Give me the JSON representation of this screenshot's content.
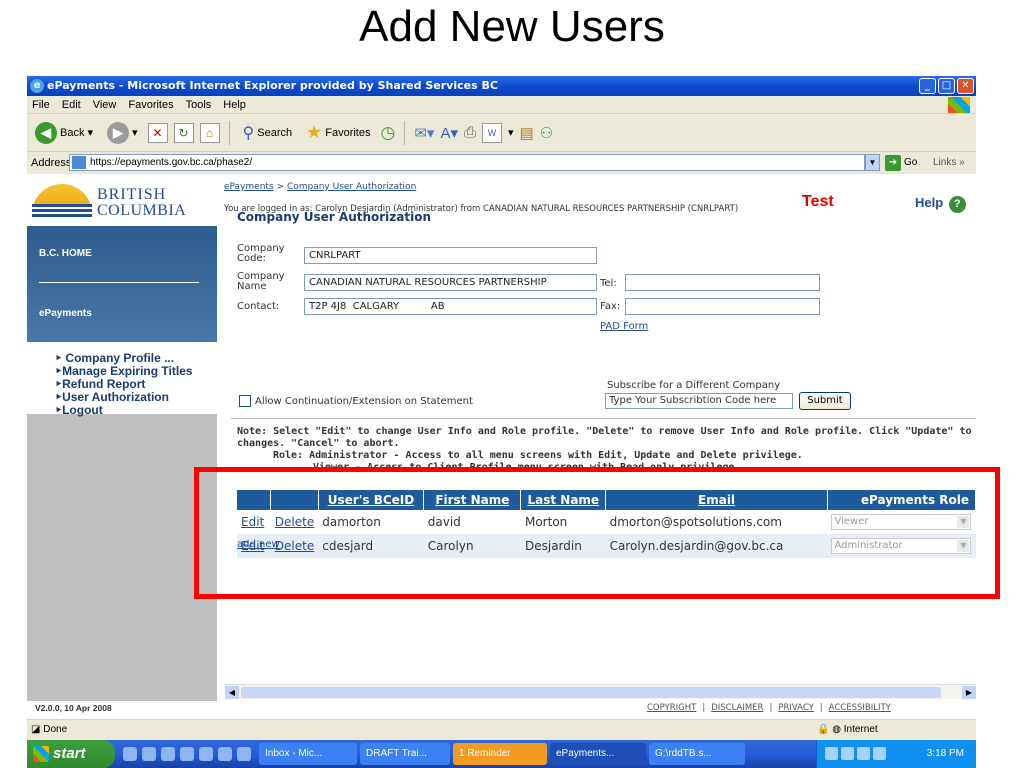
{
  "slide": {
    "title": "Add New Users"
  },
  "window": {
    "title": "ePayments - Microsoft Internet Explorer provided by Shared Services BC",
    "menu": [
      "File",
      "Edit",
      "View",
      "Favorites",
      "Tools",
      "Help"
    ],
    "toolbar": {
      "back": "Back",
      "search": "Search",
      "favorites": "Favorites"
    },
    "address": {
      "label": "Address",
      "url": "https://epayments.gov.bc.ca/phase2/",
      "go": "Go",
      "links": "Links"
    }
  },
  "logo": {
    "line1": "BRITISH",
    "line2": "COLUMBIA"
  },
  "leftnav": {
    "banner_top": "B.C. HOME",
    "banner_bottom": "ePayments",
    "links": [
      "‣ Company Profile ...",
      "‣Manage Expiring Titles",
      "‣Refund Report",
      "‣User Authorization",
      "‣Logout"
    ]
  },
  "header": {
    "breadcrumb_home": "ePayments",
    "breadcrumb_sep": ">",
    "breadcrumb_current": "Company User Authorization",
    "logged_in": "You are logged in as: Carolyn Desjardin (Administrator) from CANADIAN NATURAL RESOURCES PARTNERSHIP (CNRLPART)",
    "test": "Test",
    "help": "Help",
    "section_title": "Company User Authorization"
  },
  "company": {
    "code_label": "Company Code:",
    "code": "CNRLPART",
    "name_label": "Company Name",
    "name": "CANADIAN NATURAL RESOURCES PARTNERSHIP",
    "tel_label": "Tel:",
    "tel": "",
    "contact_label": "Contact:",
    "contact": "T2P 4J8  CALGARY          AB",
    "fax_label": "Fax:",
    "fax": "",
    "pad_form": "PAD Form"
  },
  "options": {
    "allow_label": "Allow Continuation/Extension on Statement",
    "subscribe_title": "Subscribe for a Different Company",
    "subscribe_placeholder": "Type Your Subscribtion Code here",
    "submit": "Submit"
  },
  "note": {
    "line1": "Note: Select \"Edit\" to change User Info and Role profile. \"Delete\" to remove User Info and Role profile. Click \"Update\" to save",
    "line2": "changes. \"Cancel\" to abort.",
    "line3": "Role: Administrator - Access to all menu screens with Edit, Update and Delete privilege.",
    "line4": "Viewer - Access to Client Profile menu screen with Read only privilege."
  },
  "users_table": {
    "headers": [
      "User's BCeID",
      "First Name",
      "Last Name",
      "Email",
      "ePayments Role"
    ],
    "edit": "Edit",
    "delete": "Delete",
    "rows": [
      {
        "bceid": "damorton",
        "first": "david",
        "last": "Morton",
        "email": "dmorton@spotsolutions.com",
        "role": "Viewer"
      },
      {
        "bceid": "cdesjard",
        "first": "Carolyn",
        "last": "Desjardin",
        "email": "Carolyn.desjardin@gov.bc.ca",
        "role": "Administrator"
      }
    ],
    "add_new": "add new"
  },
  "footer": {
    "version": "V2.0.0, 10 Apr 2008",
    "links": [
      "COPYRIGHT",
      "DISCLAIMER",
      "PRIVACY",
      "ACCESSIBILITY"
    ]
  },
  "statusbar": {
    "text": "Done",
    "zone": "Internet"
  },
  "taskbar": {
    "start": "start",
    "tasks": [
      "Inbox - Mic...",
      "DRAFT Trai...",
      "1 Reminder",
      "ePayments...",
      "G:\\rddTB.s..."
    ],
    "clock": "3:18 PM"
  },
  "colors": {
    "highlight": "#ff0000",
    "test": "#e00000",
    "table_header": "#1e5a9c"
  }
}
